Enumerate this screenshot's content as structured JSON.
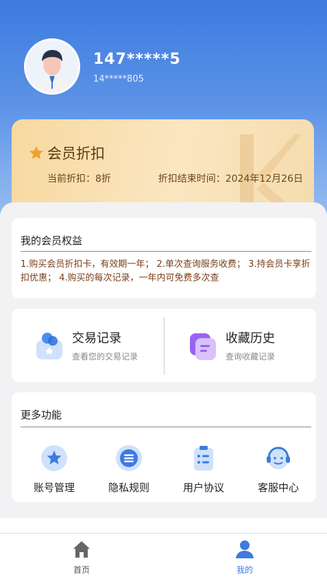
{
  "profile": {
    "phone_main": "147*****5",
    "phone_sub": "14*****805"
  },
  "vip_card": {
    "title": "会员折扣",
    "current_discount": "当前折扣：8折",
    "end_time": "折扣结束时间：2024年12月26日",
    "icon": "star-icon"
  },
  "benefits": {
    "title": "我的会员权益",
    "text": "1.购买会员折扣卡，有效期一年；  2.单次查询服务收费；  3.持会员卡享折扣优惠；  4.购买的每次记录，一年内可免费多次查"
  },
  "quick_actions": [
    {
      "title": "交易记录",
      "subtitle": "查看您的交易记录",
      "icon": "transaction-icon"
    },
    {
      "title": "收藏历史",
      "subtitle": "查询收藏记录",
      "icon": "favorites-icon"
    }
  ],
  "more": {
    "title": "更多功能",
    "items": [
      {
        "label": "账号管理",
        "icon": "star-circle-icon"
      },
      {
        "label": "隐私规则",
        "icon": "list-circle-icon"
      },
      {
        "label": "用户协议",
        "icon": "clipboard-icon"
      },
      {
        "label": "客服中心",
        "icon": "headset-icon"
      }
    ]
  },
  "tabbar": {
    "tabs": [
      {
        "label": "首页",
        "icon": "home-icon",
        "active": false
      },
      {
        "label": "我的",
        "icon": "user-icon",
        "active": true
      }
    ]
  },
  "colors": {
    "primary": "#3d7be0",
    "accent_brown": "#7a3d17",
    "tab_active": "#3d7be0",
    "tab_inactive": "#666666"
  }
}
